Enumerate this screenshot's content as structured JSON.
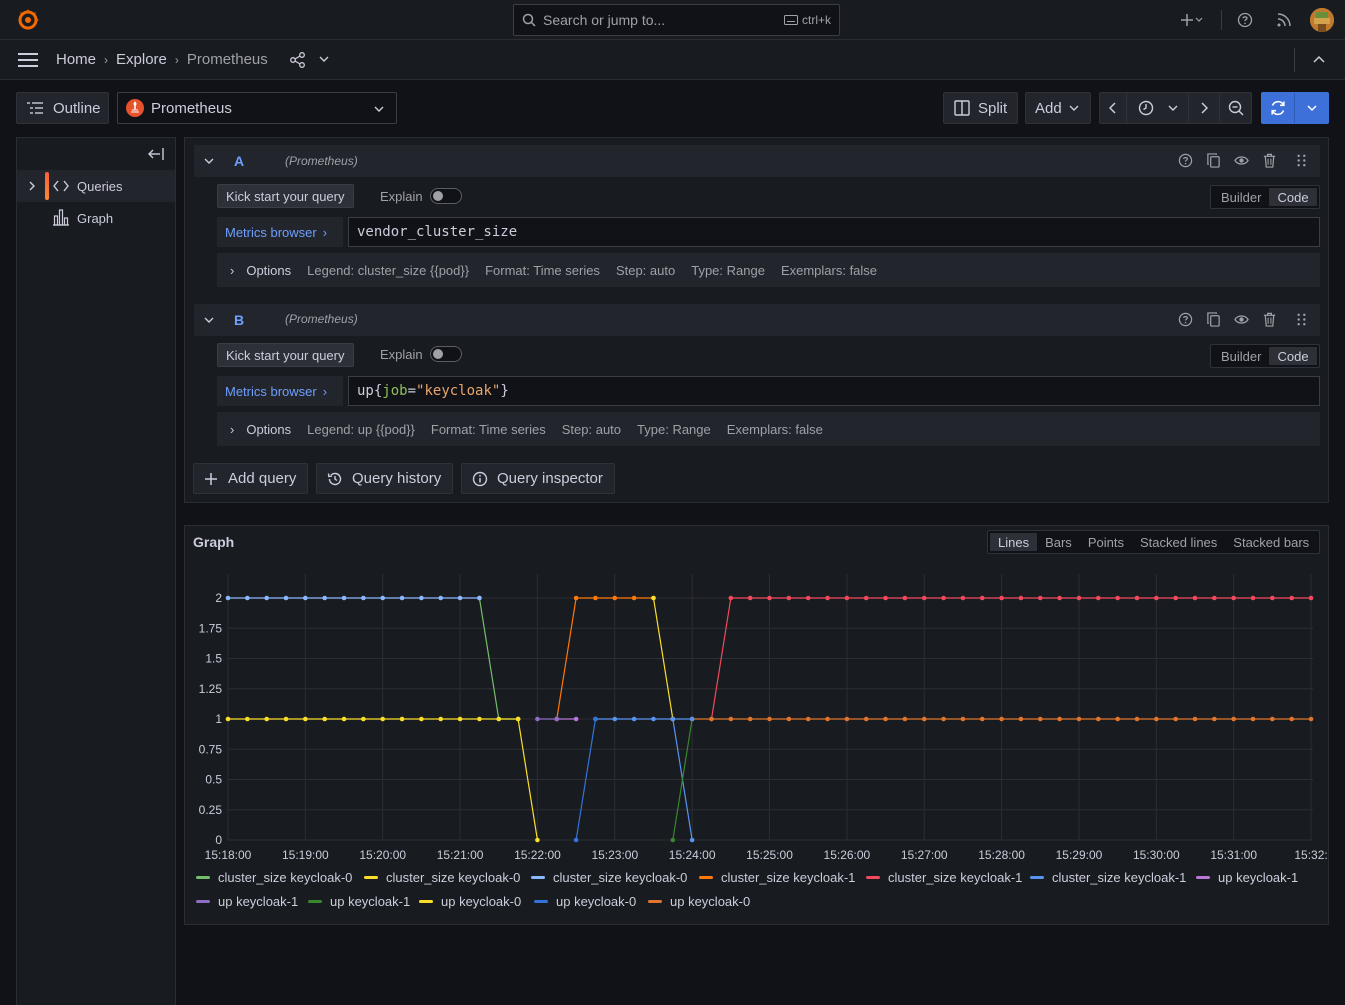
{
  "topbar": {
    "search_placeholder": "Search or jump to...",
    "search_shortcut": "ctrl+k"
  },
  "nav": {
    "breadcrumbs": [
      "Home",
      "Explore",
      "Prometheus"
    ]
  },
  "toolbar": {
    "outline_label": "Outline",
    "datasource": "Prometheus",
    "split_label": "Split",
    "add_label": "Add"
  },
  "sidebar": {
    "items": [
      {
        "label": "Queries",
        "icon": "code-icon",
        "active": true
      },
      {
        "label": "Graph",
        "icon": "bar-chart-icon",
        "active": false
      }
    ]
  },
  "queries": [
    {
      "ref": "A",
      "datasource_hint": "(Prometheus)",
      "kick_label": "Kick start your query",
      "explain_label": "Explain",
      "mode_builder": "Builder",
      "mode_code": "Code",
      "metrics_browser": "Metrics browser",
      "expr": "vendor_cluster_size",
      "options_label": "Options",
      "options": [
        "Legend: cluster_size {{pod}}",
        "Format: Time series",
        "Step: auto",
        "Type: Range",
        "Exemplars: false"
      ]
    },
    {
      "ref": "B",
      "datasource_hint": "(Prometheus)",
      "kick_label": "Kick start your query",
      "explain_label": "Explain",
      "mode_builder": "Builder",
      "mode_code": "Code",
      "metrics_browser": "Metrics browser",
      "expr_parts": [
        "up{",
        "job",
        "=",
        "\"keycloak\"",
        "}"
      ],
      "options_label": "Options",
      "options": [
        "Legend: up {{pod}}",
        "Format: Time series",
        "Step: auto",
        "Type: Range",
        "Exemplars: false"
      ]
    }
  ],
  "query_actions": {
    "add_query": "Add query",
    "query_history": "Query history",
    "query_inspector": "Query inspector"
  },
  "graph_panel": {
    "title": "Graph",
    "modes": [
      "Lines",
      "Bars",
      "Points",
      "Stacked lines",
      "Stacked bars"
    ],
    "active_mode": "Lines"
  },
  "colors": {
    "green": "#73bf69",
    "yellow": "#fade2a",
    "blue": "#5794f2",
    "orange": "#ff780a",
    "red": "#f2495c",
    "purple": "#b877d9",
    "dark_purple": "#8f6cc5",
    "dark_green": "#37872d",
    "dark_blue": "#3274d9",
    "dark_orange": "#e0752d"
  },
  "chart_data": {
    "type": "line",
    "title": "Graph",
    "x_ticks": [
      "15:18:00",
      "15:19:00",
      "15:20:00",
      "15:21:00",
      "15:22:00",
      "15:23:00",
      "15:24:00",
      "15:25:00",
      "15:26:00",
      "15:27:00",
      "15:28:00",
      "15:29:00",
      "15:30:00",
      "15:31:00",
      "15:32:"
    ],
    "y_ticks": [
      "0",
      "0.25",
      "0.5",
      "0.75",
      "1",
      "1.25",
      "1.5",
      "1.75",
      "2"
    ],
    "ylim": [
      0,
      2
    ],
    "x_range_minutes": [
      0,
      14.4
    ],
    "sample_interval_seconds": 15,
    "grid": true,
    "legend_position": "bottom",
    "series": [
      {
        "name": "cluster_size keycloak-0",
        "color": "#73bf69",
        "points": [
          [
            13,
            2
          ],
          [
            14,
            1
          ],
          [
            15,
            1
          ]
        ]
      },
      {
        "name": "cluster_size keycloak-0",
        "color": "#fade2a",
        "points": [
          [
            0,
            1
          ],
          [
            1,
            1
          ],
          [
            2,
            1
          ],
          [
            3,
            1
          ],
          [
            4,
            1
          ],
          [
            5,
            1
          ],
          [
            6,
            1
          ],
          [
            7,
            1
          ],
          [
            8,
            1
          ],
          [
            9,
            1
          ],
          [
            10,
            1
          ],
          [
            11,
            1
          ],
          [
            12,
            1
          ],
          [
            13,
            1
          ],
          [
            14,
            1
          ],
          [
            15,
            1
          ]
        ]
      },
      {
        "name": "cluster_size keycloak-0",
        "color": "#8ab8ff",
        "points": [
          [
            0,
            2
          ],
          [
            1,
            2
          ],
          [
            2,
            2
          ],
          [
            3,
            2
          ],
          [
            4,
            2
          ],
          [
            5,
            2
          ],
          [
            6,
            2
          ],
          [
            7,
            2
          ],
          [
            8,
            2
          ],
          [
            9,
            2
          ],
          [
            10,
            2
          ],
          [
            11,
            2
          ],
          [
            12,
            2
          ],
          [
            13,
            2
          ]
        ]
      },
      {
        "name": "cluster_size keycloak-1",
        "color": "#ff780a",
        "points": [
          [
            17,
            1
          ],
          [
            18,
            2
          ],
          [
            19,
            2
          ],
          [
            20,
            2
          ],
          [
            21,
            2
          ],
          [
            22,
            2
          ]
        ]
      },
      {
        "name": "cluster_size keycloak-1",
        "color": "#f2495c",
        "points": [
          [
            25,
            1
          ],
          [
            26,
            2
          ],
          [
            27,
            2
          ],
          [
            28,
            2
          ],
          [
            29,
            2
          ],
          [
            30,
            2
          ],
          [
            31,
            2
          ],
          [
            32,
            2
          ],
          [
            33,
            2
          ],
          [
            34,
            2
          ],
          [
            35,
            2
          ],
          [
            36,
            2
          ],
          [
            37,
            2
          ],
          [
            38,
            2
          ],
          [
            39,
            2
          ],
          [
            40,
            2
          ],
          [
            41,
            2
          ],
          [
            42,
            2
          ],
          [
            43,
            2
          ],
          [
            44,
            2
          ],
          [
            45,
            2
          ],
          [
            46,
            2
          ],
          [
            47,
            2
          ],
          [
            48,
            2
          ],
          [
            49,
            2
          ],
          [
            50,
            2
          ],
          [
            51,
            2
          ],
          [
            52,
            2
          ],
          [
            53,
            2
          ],
          [
            54,
            2
          ],
          [
            55,
            2
          ],
          [
            56,
            2
          ]
        ]
      },
      {
        "name": "cluster_size keycloak-1",
        "color": "#5794f2",
        "points": [
          [
            19,
            1
          ],
          [
            20,
            1
          ],
          [
            21,
            1
          ],
          [
            22,
            1
          ],
          [
            23,
            1
          ],
          [
            24,
            0
          ]
        ]
      },
      {
        "name": "up keycloak-1",
        "color": "#b877d9",
        "points": [
          [
            17,
            1
          ],
          [
            18,
            1
          ]
        ]
      },
      {
        "name": "up keycloak-1",
        "color": "#8f6cc5",
        "points": [
          [
            16,
            1
          ],
          [
            17,
            1
          ]
        ]
      },
      {
        "name": "up keycloak-1",
        "color": "#37872d",
        "points": [
          [
            23,
            0
          ],
          [
            24,
            1
          ]
        ]
      },
      {
        "name": "up keycloak-0",
        "color": "#fade2a",
        "points": [
          [
            15,
            1
          ],
          [
            16,
            0
          ]
        ]
      },
      {
        "name": "up keycloak-0",
        "color": "#3274d9",
        "points": [
          [
            18,
            0
          ],
          [
            19,
            1
          ]
        ]
      },
      {
        "name": "up keycloak-0",
        "color": "#e0752d",
        "points": [
          [
            24,
            1
          ],
          [
            25,
            1
          ],
          [
            26,
            1
          ],
          [
            27,
            1
          ],
          [
            28,
            1
          ],
          [
            29,
            1
          ],
          [
            30,
            1
          ],
          [
            31,
            1
          ],
          [
            32,
            1
          ],
          [
            33,
            1
          ],
          [
            34,
            1
          ],
          [
            35,
            1
          ],
          [
            36,
            1
          ],
          [
            37,
            1
          ],
          [
            38,
            1
          ],
          [
            39,
            1
          ],
          [
            40,
            1
          ],
          [
            41,
            1
          ],
          [
            42,
            1
          ],
          [
            43,
            1
          ],
          [
            44,
            1
          ],
          [
            45,
            1
          ],
          [
            46,
            1
          ],
          [
            47,
            1
          ],
          [
            48,
            1
          ],
          [
            49,
            1
          ],
          [
            50,
            1
          ],
          [
            51,
            1
          ],
          [
            52,
            1
          ],
          [
            53,
            1
          ],
          [
            54,
            1
          ],
          [
            55,
            1
          ],
          [
            56,
            1
          ]
        ]
      },
      {
        "name": "",
        "color": "#fade2a",
        "points": [
          [
            22,
            2
          ],
          [
            23,
            1
          ]
        ]
      },
      {
        "name": "",
        "color": "#5794f2",
        "points": [
          [
            23,
            1
          ],
          [
            24,
            1
          ]
        ]
      }
    ],
    "legend": [
      {
        "name": "cluster_size keycloak-0",
        "color": "#73bf69"
      },
      {
        "name": "cluster_size keycloak-0",
        "color": "#fade2a"
      },
      {
        "name": "cluster_size keycloak-0",
        "color": "#8ab8ff"
      },
      {
        "name": "cluster_size keycloak-1",
        "color": "#ff780a"
      },
      {
        "name": "cluster_size keycloak-1",
        "color": "#f2495c"
      },
      {
        "name": "cluster_size keycloak-1",
        "color": "#5794f2"
      },
      {
        "name": "up keycloak-1",
        "color": "#b877d9"
      },
      {
        "name": "up keycloak-1",
        "color": "#8f6cc5"
      },
      {
        "name": "up keycloak-1",
        "color": "#37872d"
      },
      {
        "name": "up keycloak-0",
        "color": "#fade2a"
      },
      {
        "name": "up keycloak-0",
        "color": "#3274d9"
      },
      {
        "name": "up keycloak-0",
        "color": "#e0752d"
      }
    ]
  }
}
